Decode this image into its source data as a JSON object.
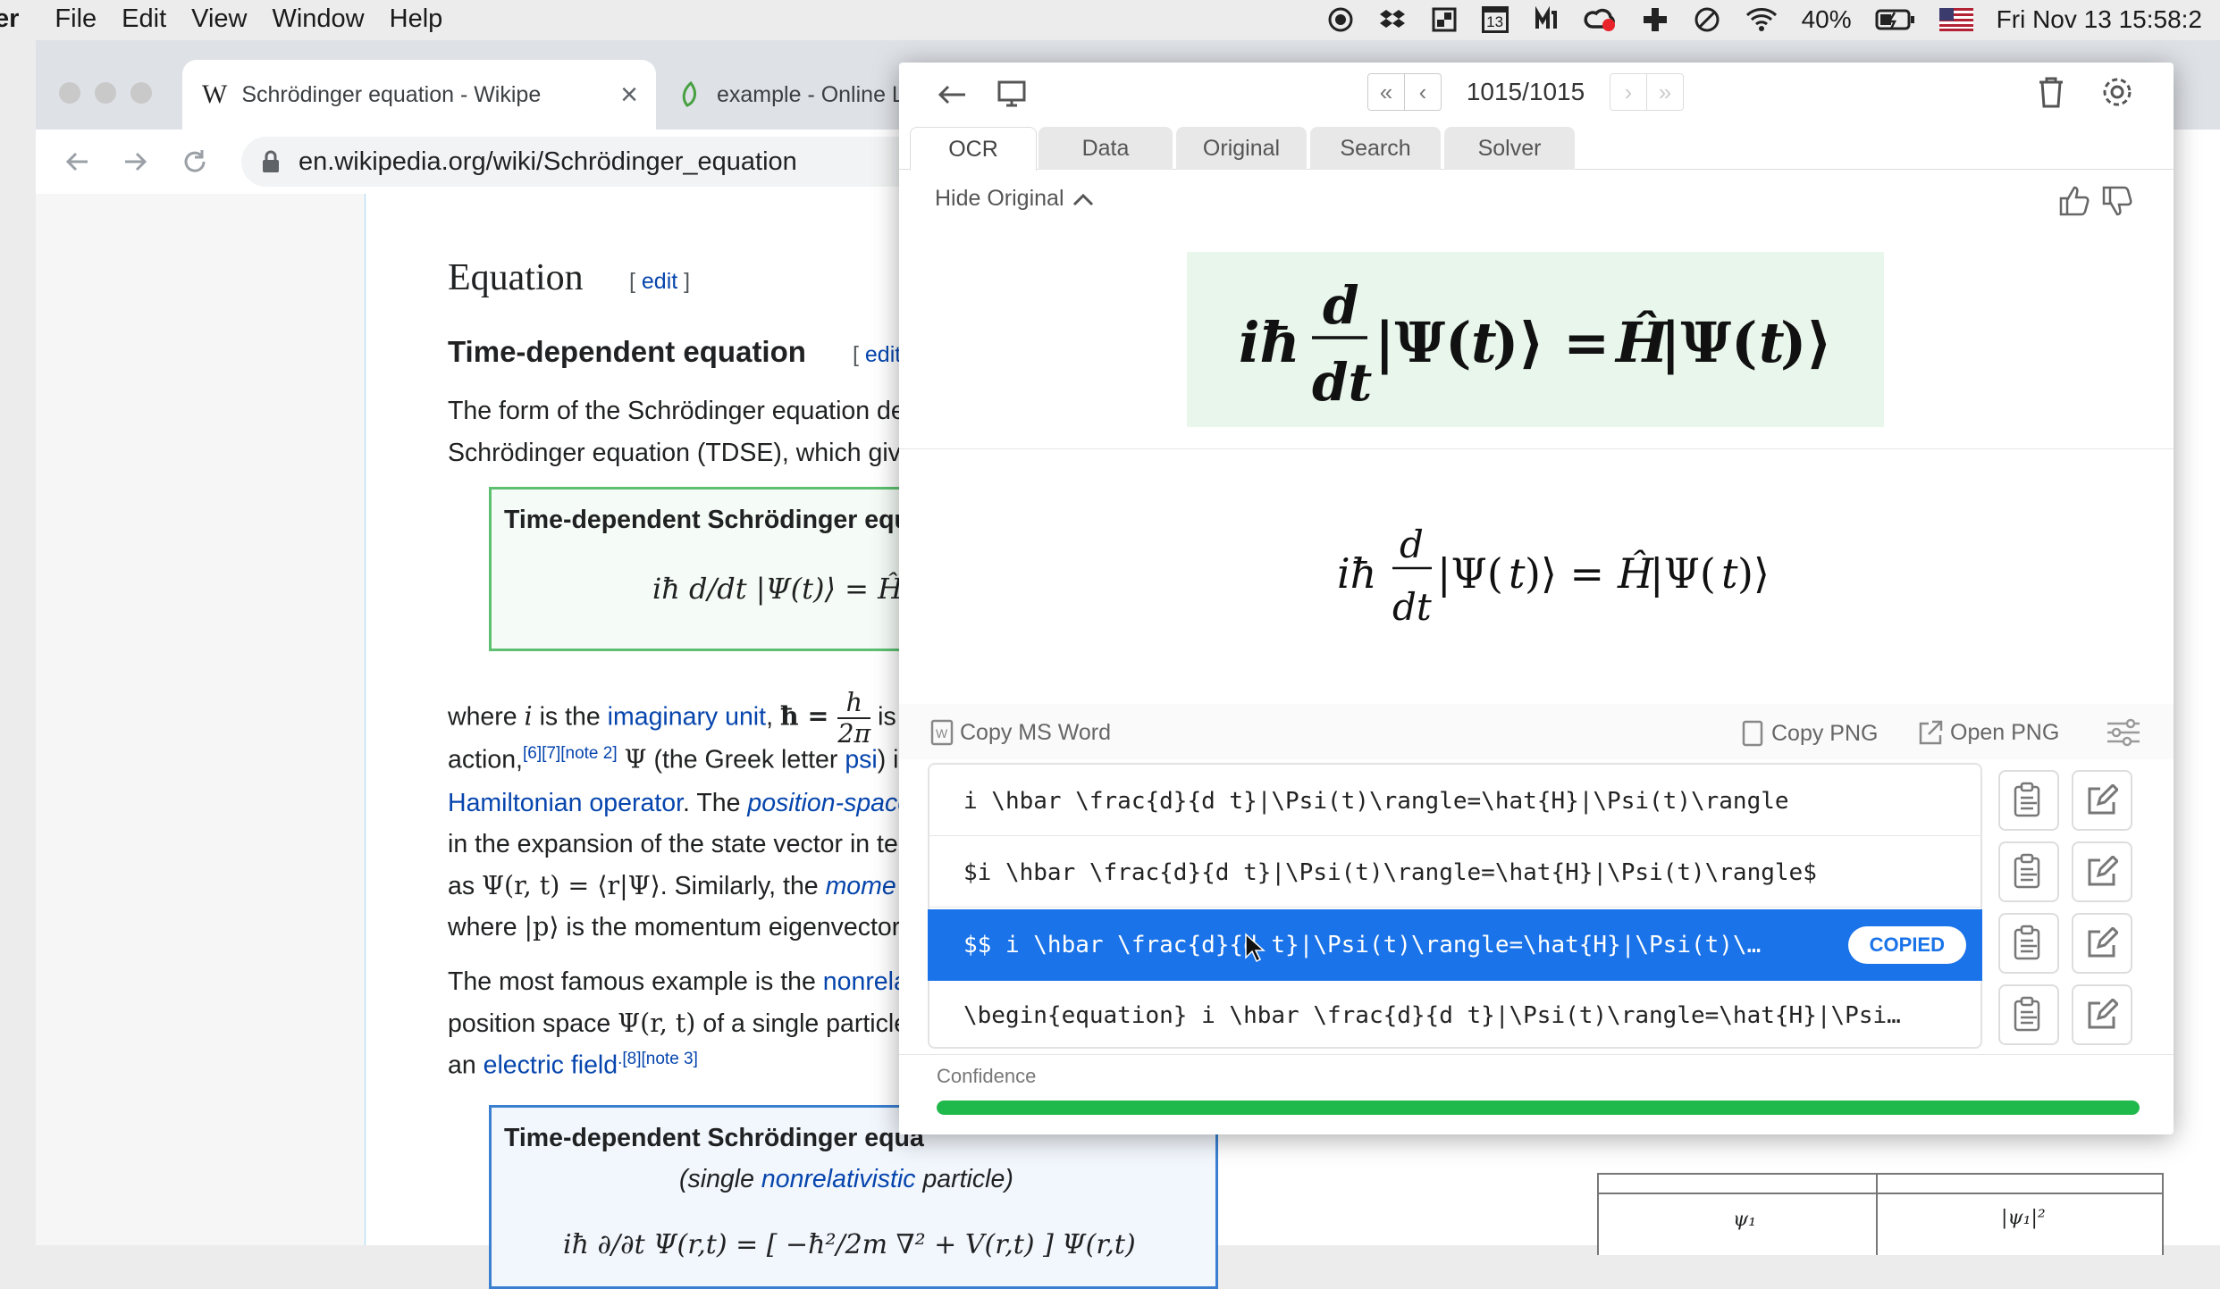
{
  "menubar": {
    "app": "er",
    "items": [
      "File",
      "Edit",
      "View",
      "Window",
      "Help"
    ],
    "battery": "40%",
    "calendar_day": "13",
    "datetime": "Fri Nov 13  15:58:2"
  },
  "browser": {
    "tabs": [
      {
        "title": "Schrödinger equation - Wikipe",
        "close": "×"
      },
      {
        "title": "example - Online La"
      }
    ],
    "url": "en.wikipedia.org/wiki/Schrödinger_equation"
  },
  "wiki": {
    "h2": "Equation",
    "edit1": "edit",
    "h3": "Time-dependent equation",
    "edit2": "edit",
    "p1a": "The form of the Schrödinger equation dep",
    "p1b": "Schrödinger equation (TDSE), which gives",
    "box1_title": "Time-dependent Schrödinger equa",
    "box1_eq": "iħ d/dt |Ψ(t)⟩ = Ĥ|Ψ(t)",
    "where_a": "where ",
    "where_i": "i",
    "where_b": " is the ",
    "imaginary_unit": "imaginary unit",
    "hbar_eq": "ħ = ",
    "h": "h",
    "two_pi": "2π",
    "is": "is",
    "action": "action,",
    "sup1": "[6][7][note 2]",
    "psi": "Ψ",
    "greek": "(the Greek letter ",
    "psi_link": "psi",
    "greek_end": ") i",
    "hamiltonian": "Hamiltonian operator",
    "the": ". The ",
    "position_space": "position-space",
    "expansion": "in the expansion of the state vector in term",
    "as": "as ",
    "as_eq": "Ψ(r, t) = ⟨r|Ψ⟩",
    "similarly": ". Similarly, the ",
    "mome": "mome",
    "where_p_a": "where ",
    "where_p_eq": "|p⟩",
    "where_p_b": " is the momentum eigenvector.",
    "famous_a": "The most famous example is the ",
    "nonrelati": "nonrelati",
    "position_space2": "position space ",
    "pos_eq": "Ψ(r, t)",
    "single": " of a single particle",
    "an": "an ",
    "electric": "electric field",
    "sup2": ".[8][note 3]",
    "box2_title": "Time-dependent Schrödinger equa",
    "box2_sub_a": "(single ",
    "box2_sub_link": "nonrelativistic",
    "box2_sub_b": " particle)",
    "box2_eq": "iħ ∂/∂t Ψ(r,t) = [ −ħ²/2m ∇² + V(r,t) ] Ψ(r,t)",
    "graph_label1": "ψ₁",
    "graph_label2": "|ψ₁|²"
  },
  "panel": {
    "counter": "1015/1015",
    "tabs": [
      "OCR",
      "Data",
      "Original",
      "Search",
      "Solver"
    ],
    "hide_original": "Hide Original",
    "copy_ms_word": "Copy MS Word",
    "copy_png": "Copy PNG",
    "open_png": "Open PNG",
    "rows": [
      "i \\hbar \\frac{d}{d t}|\\Psi(t)\\rangle=\\hat{H}|\\Psi(t)\\rangle",
      "$i \\hbar \\frac{d}{d t}|\\Psi(t)\\rangle=\\hat{H}|\\Psi(t)\\rangle$",
      "$$ i \\hbar \\frac{d}{d t}|\\Psi(t)\\rangle=\\hat{H}|\\Psi(t)\\…",
      "\\begin{equation} i \\hbar \\frac{d}{d t}|\\Psi(t)\\rangle=\\hat{H}|\\Psi…"
    ],
    "copied": "COPIED",
    "confidence_label": "Confidence",
    "confidence": 1.0
  },
  "colors": {
    "accent": "#1a73e8",
    "link": "#0645ad",
    "confidence_bar": "#1fb84a",
    "green_box": "#e8f6ec"
  }
}
